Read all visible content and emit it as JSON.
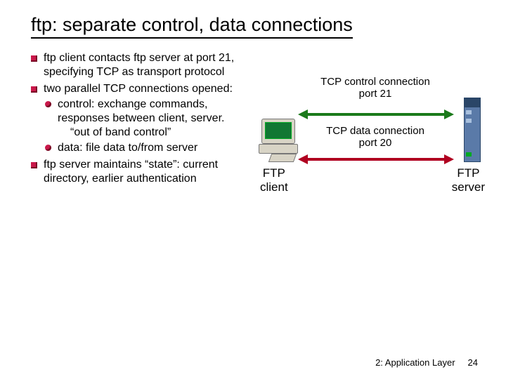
{
  "title": "ftp: separate control, data connections",
  "bullets": {
    "b1": "ftp client contacts ftp server at port 21, specifying TCP as transport protocol",
    "b2": "two parallel TCP connections opened:",
    "b2a_lead": "control:",
    "b2a_rest": " exchange commands, responses between client, server.",
    "b2a_quote": "“out of band control”",
    "b2b_lead": "data:",
    "b2b_rest": " file data to/from server",
    "b3": "ftp server maintains “state”: current directory, earlier authentication"
  },
  "diagram": {
    "ctrl_l1": "TCP control connection",
    "ctrl_l2": "port 21",
    "data_l1": "TCP data connection",
    "data_l2": "port 20",
    "client": "FTP\nclient",
    "server": "FTP\nserver"
  },
  "footer": {
    "section": "2: Application Layer",
    "page": "24"
  }
}
